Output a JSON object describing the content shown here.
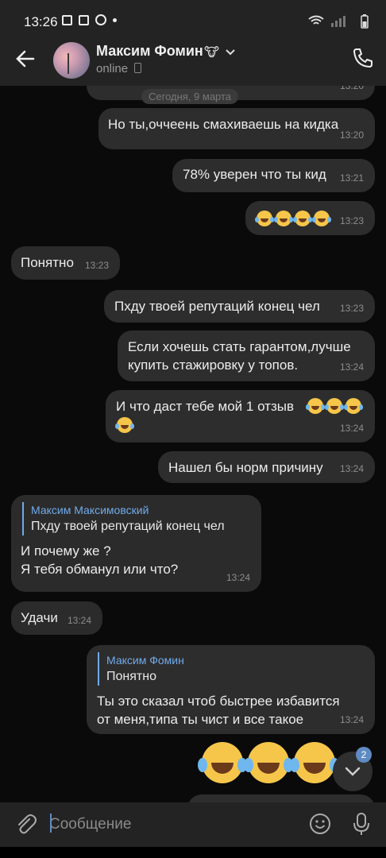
{
  "status_bar": {
    "time": "13:26"
  },
  "header": {
    "contact_name": "Максим Фомин",
    "name_emoji": "🐮",
    "status": "online"
  },
  "date_separator": "Сегодня, 9 марта",
  "top_partial_time": "13:20",
  "messages": [
    {
      "text": "Но ты,оччеень смахиваешь на кидка",
      "time": "13:20"
    },
    {
      "text": "78% уверен что ты кид",
      "time": "13:21"
    },
    {
      "text": "😂😂😂😂",
      "time": "13:23"
    },
    {
      "text": "Понятно",
      "time": "13:23"
    },
    {
      "text": "Пхду твоей репутаций конец чел",
      "time": "13:23"
    },
    {
      "line1": "Если хочешь стать гарантом,лучше",
      "line2": "купить стажировку у топов.",
      "time": "13:24"
    },
    {
      "line1": "И что даст тебе мой 1 отзыв",
      "time": "13:24"
    },
    {
      "text": "Нашел бы норм причину",
      "time": "13:24"
    },
    {
      "reply_name": "Максим Максимовский",
      "reply_text": "Пхду твоей репутаций конец чел",
      "line1": "И почему же ?",
      "line2": "Я тебя обманул или что?",
      "time": "13:24"
    },
    {
      "text": "Удачи",
      "time": "13:24"
    },
    {
      "reply_name": "Максим Фомин",
      "reply_text": "Понятно",
      "line1": "Ты это сказал чтоб быстрее избавится",
      "line2": "от меня,типа ты чист и все такое",
      "time": "13:24"
    }
  ],
  "unread_badge": "2",
  "composer": {
    "placeholder": "Сообщение"
  }
}
